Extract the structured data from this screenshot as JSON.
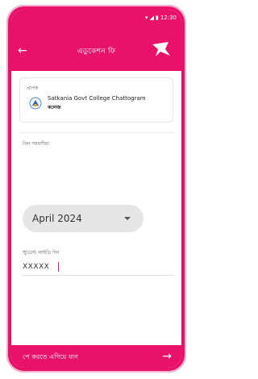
{
  "status_bar": {
    "time": "12:30",
    "icons": [
      "wifi-icon",
      "signal-icon",
      "battery-icon"
    ]
  },
  "appbar": {
    "title": "এডুকেশন ফি",
    "back_icon": "arrow-left",
    "logo_icon": "bird-logo"
  },
  "receiver": {
    "label": "প্রাপক",
    "name": "Satkania Govt College Chattogram",
    "subtitle": "কলেজ",
    "icon": "college-emblem"
  },
  "period": {
    "label": "বিল সময়সীমা",
    "selected": "April 2024"
  },
  "student_id": {
    "label": "স্টুডেন্ট আইডি দিন",
    "value": "XXXXX"
  },
  "footer": {
    "label": "পে করতে এগিয়ে যান",
    "arrow_icon": "arrow-right"
  },
  "colors": {
    "primary": "#e8126b",
    "background": "#ffffff",
    "dropdown_bg": "#e6e6e6"
  }
}
